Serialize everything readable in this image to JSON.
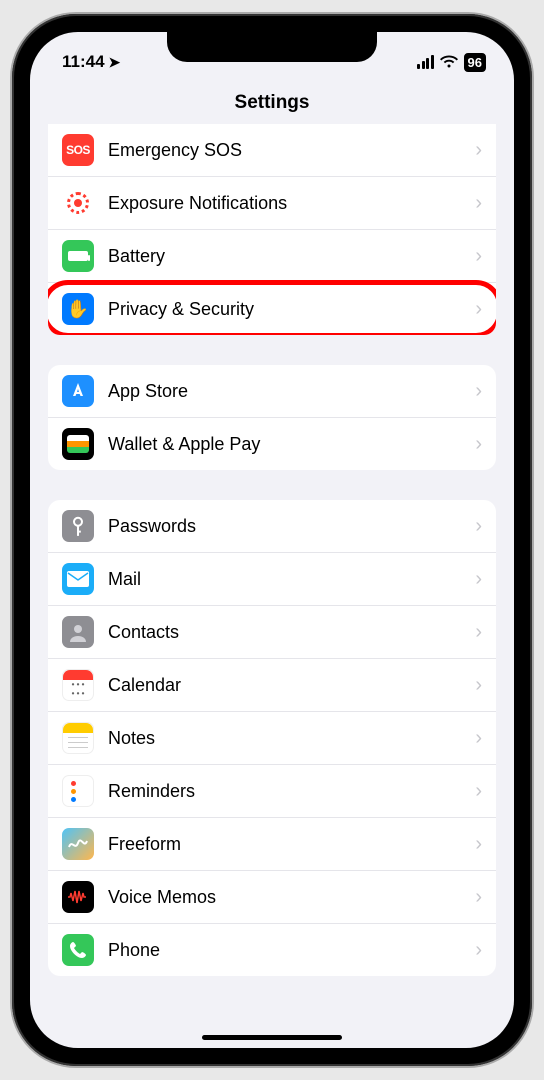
{
  "status": {
    "time": "11:44",
    "battery": "96"
  },
  "header": {
    "title": "Settings"
  },
  "groups": [
    {
      "rows": [
        {
          "label": "Emergency SOS",
          "icon": "sos"
        },
        {
          "label": "Exposure Notifications",
          "icon": "exposure"
        },
        {
          "label": "Battery",
          "icon": "battery"
        },
        {
          "label": "Privacy & Security",
          "icon": "privacy",
          "highlighted": true
        }
      ]
    },
    {
      "rows": [
        {
          "label": "App Store",
          "icon": "appstore"
        },
        {
          "label": "Wallet & Apple Pay",
          "icon": "wallet"
        }
      ]
    },
    {
      "rows": [
        {
          "label": "Passwords",
          "icon": "passwords"
        },
        {
          "label": "Mail",
          "icon": "mail"
        },
        {
          "label": "Contacts",
          "icon": "contacts"
        },
        {
          "label": "Calendar",
          "icon": "calendar"
        },
        {
          "label": "Notes",
          "icon": "notes"
        },
        {
          "label": "Reminders",
          "icon": "reminders"
        },
        {
          "label": "Freeform",
          "icon": "freeform"
        },
        {
          "label": "Voice Memos",
          "icon": "voicememos"
        },
        {
          "label": "Phone",
          "icon": "phone"
        }
      ]
    }
  ]
}
